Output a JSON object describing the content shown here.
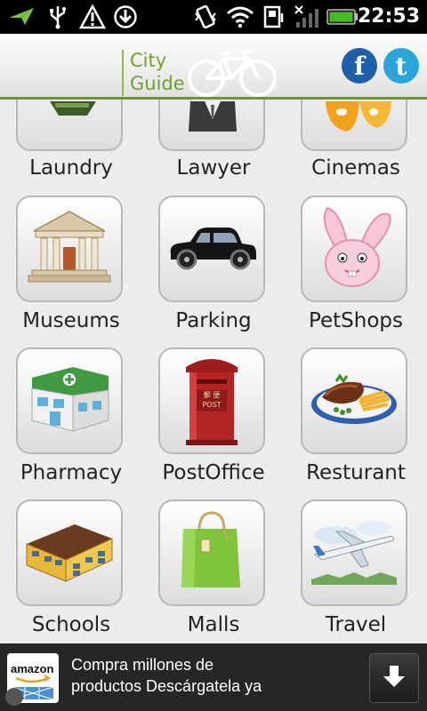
{
  "status_bar": {
    "time": "22:53",
    "icons": [
      "notification-arrow-icon",
      "usb-icon",
      "warning-icon",
      "download-icon",
      "vibrate-icon",
      "wifi-icon",
      "sim-icon",
      "signal-icon",
      "battery-icon"
    ]
  },
  "header": {
    "logo_line1": "City",
    "logo_line2": "Guide",
    "accent_color": "#6a9a2c",
    "facebook_label": "f",
    "twitter_label": "t"
  },
  "grid": {
    "items": [
      {
        "label": "Laundry",
        "icon": "laundry-icon"
      },
      {
        "label": "Lawyer",
        "icon": "lawyer-icon"
      },
      {
        "label": "Cinemas",
        "icon": "cinema-masks-icon"
      },
      {
        "label": "Museums",
        "icon": "museum-building-icon"
      },
      {
        "label": "Parking",
        "icon": "car-icon"
      },
      {
        "label": "PetShops",
        "icon": "bunny-icon"
      },
      {
        "label": "Pharmacy",
        "icon": "pharmacy-building-icon"
      },
      {
        "label": "PostOffice",
        "icon": "post-box-icon"
      },
      {
        "label": "Resturant",
        "icon": "food-plate-icon"
      },
      {
        "label": "Schools",
        "icon": "school-building-icon"
      },
      {
        "label": "Malls",
        "icon": "shopping-bag-icon"
      },
      {
        "label": "Travel",
        "icon": "airplane-icon"
      }
    ],
    "postbox_text1": "郵 便",
    "postbox_text2": "POST"
  },
  "ad": {
    "brand": "amazon",
    "line1": "Compra millones de",
    "line2": "productos Descárgatela ya"
  }
}
